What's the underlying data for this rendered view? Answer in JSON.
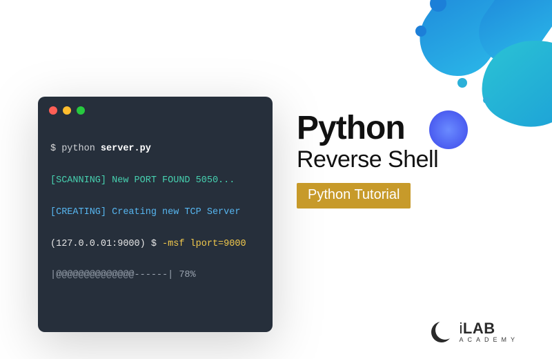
{
  "terminal": {
    "line1": {
      "prompt": "$ ",
      "cmd": "python ",
      "file": "server.py"
    },
    "line2": "[SCANNING] New PORT FOUND 5050...",
    "line3": "[CREATING] Creating new TCP Server",
    "line4": {
      "addr": "(127.0.0.01:9000)",
      "prompt2": " $ ",
      "flag": "-msf lport=9000"
    },
    "line5": "|@@@@@@@@@@@@@@------| 78%"
  },
  "titles": {
    "main": "Python",
    "sub": "Reverse Shell",
    "badge": "Python Tutorial"
  },
  "logo": {
    "name_i": "i",
    "name_lab": "LAB",
    "sub": "ACADEMY"
  },
  "colors": {
    "terminal_bg": "#262f3b",
    "badge_bg": "#c79a2a",
    "blob_blue": "#1c7fd8",
    "blob_cyan": "#2bc3d4",
    "blob_purple": "#5b6bf0"
  }
}
